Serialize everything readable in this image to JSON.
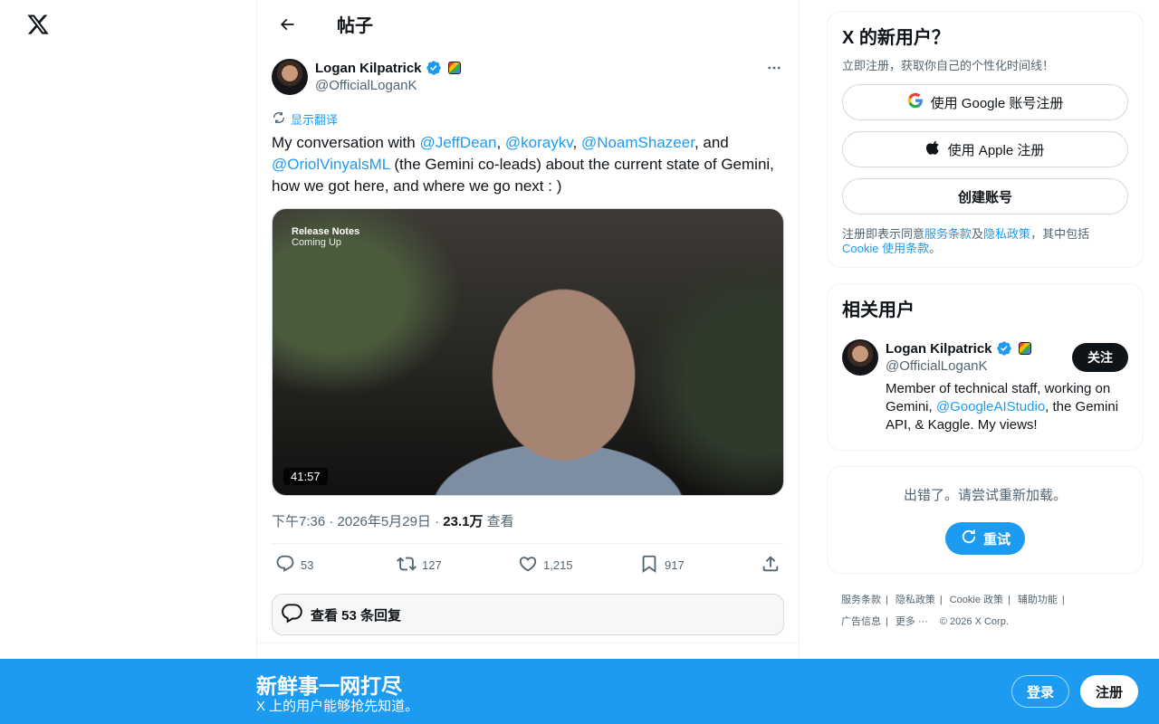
{
  "header": {
    "title": "帖子"
  },
  "post": {
    "author_name": "Logan Kilpatrick",
    "author_handle": "@OfficialLoganK",
    "translate_label": "显示翻译",
    "text": {
      "t1": "My conversation with ",
      "m1": "@JeffDean",
      "t2": ", ",
      "m2": "@koraykv",
      "t3": ", ",
      "m3": "@NoamShazeer",
      "t4": ", and ",
      "m4": "@OriolVinyalsML",
      "t5": " (the Gemini co-leads) about the current state of Gemini, how we got here, and where we go next : )"
    },
    "media": {
      "caption_title": "Release Notes",
      "caption_sub": "Coming Up",
      "duration": "41:57"
    },
    "time": "下午7:36 · 2026年5月29日 · ",
    "views_count": "23.1万",
    "views_label": " 查看",
    "actions": {
      "replies": "53",
      "reposts": "127",
      "likes": "1,215",
      "bookmarks": "917"
    },
    "view_replies_label": "查看 53 条回复"
  },
  "signup_card": {
    "title": "X 的新用户？",
    "subtitle": "立即注册，获取你自己的个性化时间线！",
    "google_label": "使用 Google 账号注册",
    "apple_label": "使用 Apple 注册",
    "create_label": "创建账号",
    "terms_prefix": "注册即表示同意",
    "terms_link": "服务条款",
    "terms_and": "及",
    "privacy_link": "隐私政策",
    "terms_mid": "，其中包括 ",
    "cookie_link": "Cookie 使用条款",
    "terms_end": "。"
  },
  "related": {
    "title": "相关用户",
    "name": "Logan Kilpatrick",
    "handle": "@OfficialLoganK",
    "follow_label": "关注",
    "bio_t1": "Member of technical staff, working on Gemini, ",
    "bio_mention": "@GoogleAIStudio",
    "bio_t2": ", the Gemini API, & Kaggle. My views!"
  },
  "error_card": {
    "message": "出错了。请尝试重新加载。",
    "retry_label": "重试"
  },
  "footer": {
    "links": [
      "服务条款",
      "隐私政策",
      "Cookie 政策",
      "辅助功能",
      "广告信息",
      "更多 ···"
    ],
    "copyright": "© 2026 X Corp."
  },
  "bottom_bar": {
    "title": "新鲜事一网打尽",
    "subtitle": "X 上的用户能够抢先知道。",
    "login_label": "登录",
    "signup_label": "注册"
  },
  "colors": {
    "accent": "#1d9bf0",
    "text": "#0f1419",
    "muted": "#536471"
  }
}
